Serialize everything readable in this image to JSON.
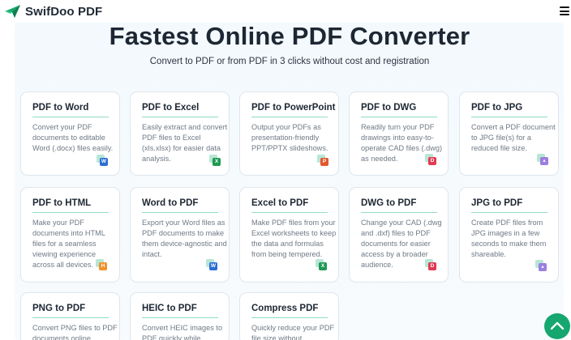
{
  "header": {
    "brand": "SwifDoo PDF",
    "brand_color": "#18a96b",
    "menu_icon": "hamburger-menu-icon"
  },
  "hero": {
    "title": "Fastest Online PDF Converter",
    "subtitle": "Convert to PDF or from PDF in 3 clicks without cost and registration"
  },
  "cards": [
    {
      "title": "PDF to Word",
      "desc": "Convert your PDF documents to editable Word (.docx) files easily.",
      "icon": "word-file-icon",
      "letter": "W",
      "color": "#2b6fd6"
    },
    {
      "title": "PDF to Excel",
      "desc": "Easily extract and convert PDF files to Excel (xls.xlsx) for easier data analysis.",
      "icon": "excel-file-icon",
      "letter": "X",
      "color": "#1f9a52"
    },
    {
      "title": "PDF to PowerPoint",
      "desc": "Output your PDFs as presentation-friendly PPT/PPTX slideshows.",
      "icon": "powerpoint-file-icon",
      "letter": "P",
      "color": "#e0582f"
    },
    {
      "title": "PDF to DWG",
      "desc": "Readily turn your PDF drawings into easy-to-operate CAD files (.dwg) as needed.",
      "icon": "dwg-file-icon",
      "letter": "D",
      "color": "#e23a54"
    },
    {
      "title": "PDF to JPG",
      "desc": "Convert a PDF document to JPG file(s) for a reduced file size.",
      "icon": "image-file-icon",
      "letter": "▴",
      "color": "#9a7fe0"
    },
    {
      "title": "PDF to HTML",
      "desc": "Make your PDF documents into HTML files for a seamless viewing experience across all devices.",
      "icon": "html-file-icon",
      "letter": "H",
      "color": "#f0922b"
    },
    {
      "title": "Word to PDF",
      "desc": "Export your Word files as PDF documents to make them device-agnostic and intact.",
      "icon": "word-file-icon",
      "letter": "W",
      "color": "#2b6fd6"
    },
    {
      "title": "Excel to PDF",
      "desc": "Make PDF files from your Excel worksheets to keep the data and formulas from being tempered.",
      "icon": "excel-file-icon",
      "letter": "X",
      "color": "#1f9a52"
    },
    {
      "title": "DWG to PDF",
      "desc": "Change your CAD (.dwg and .dxf) files to PDF documents for easier access by a broader audience.",
      "icon": "dwg-file-icon",
      "letter": "D",
      "color": "#e23a54"
    },
    {
      "title": "JPG to PDF",
      "desc": "Create PDF files from JPG images in a few seconds to make them shareable.",
      "icon": "image-file-icon",
      "letter": "▴",
      "color": "#9a7fe0"
    },
    {
      "title": "PNG to PDF",
      "desc": "Convert PNG files to PDF documents online",
      "icon": "",
      "letter": "",
      "color": ""
    },
    {
      "title": "HEIC to PDF",
      "desc": "Convert HEIC images to PDF quickly while",
      "icon": "",
      "letter": "",
      "color": ""
    },
    {
      "title": "Compress PDF",
      "desc": "Quickly reduce your PDF file size without",
      "icon": "",
      "letter": "",
      "color": ""
    }
  ],
  "scroll_top_icon": "chevron-up-icon"
}
